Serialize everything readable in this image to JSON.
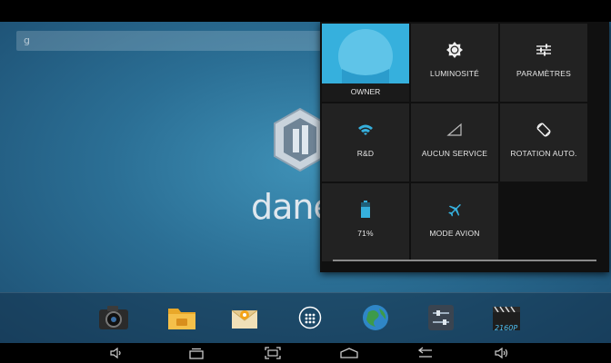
{
  "quick_settings": {
    "owner": {
      "label": "OWNER"
    },
    "brightness": {
      "label": "LUMINOSITÉ"
    },
    "settings": {
      "label": "PARAMÈTRES"
    },
    "wifi": {
      "label": "R&D"
    },
    "mobile": {
      "label": "AUCUN SERVICE"
    },
    "rotation": {
      "label": "ROTATION AUTO."
    },
    "battery": {
      "label": "71%",
      "level": 0.71
    },
    "airplane": {
      "label": "MODE AVION"
    }
  },
  "home": {
    "search_glyph": "g",
    "brand_text": "dane"
  },
  "dock": {
    "items": [
      "camera-icon",
      "folder-icon",
      "email-icon",
      "app-drawer-icon",
      "browser-icon",
      "settings-app-icon",
      "video-player-icon"
    ],
    "video_badge": "2160P"
  },
  "nav": {
    "buttons": [
      "volume-down-icon",
      "recent-apps-icon",
      "screenshot-icon",
      "home-icon",
      "back-icon",
      "volume-up-icon"
    ]
  },
  "colors": {
    "accent": "#36b0dd",
    "panel": "#101010",
    "tile": "#222222"
  }
}
